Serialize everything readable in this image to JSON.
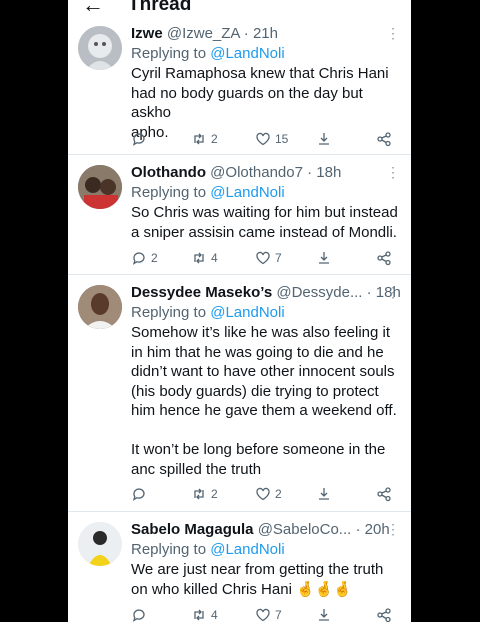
{
  "header": {
    "title": "Thread",
    "back_icon": "arrow-left-icon"
  },
  "tweets": [
    {
      "display_name": "Izwe",
      "handle": "@Izwe_ZA",
      "time": "· 21h",
      "replying_prefix": "Replying to ",
      "replying_to": "@LandNoli",
      "text": "Cyril Ramaphosa knew that Chris Hani\nhad no body guards on the day but askho\napho.",
      "replies": "",
      "retweets": "2",
      "likes": "15"
    },
    {
      "display_name": "Olothando",
      "handle": "@Olothando7",
      "time": "· 18h",
      "replying_prefix": "Replying to ",
      "replying_to": "@LandNoli",
      "text": "So Chris was waiting for him but instead\na sniper assisin came instead of Mondli.",
      "replies": "2",
      "retweets": "4",
      "likes": "7"
    },
    {
      "display_name": "Dessydee Maseko’s",
      "handle": "@Dessyde...",
      "time": "· 18h",
      "replying_prefix": "Replying to ",
      "replying_to": "@LandNoli",
      "text": "Somehow it’s like he was also feeling it\nin him that he was going to die and he\ndidn’t want to have other innocent souls\n(his body guards) die trying to protect\nhim hence he gave them a weekend off.\n\nIt won’t be long before someone in the\nanc spilled the truth",
      "replies": "",
      "retweets": "2",
      "likes": "2"
    },
    {
      "display_name": "Sabelo Magagula",
      "handle": "@SabeloCo...",
      "time": "· 20h",
      "replying_prefix": "Replying to ",
      "replying_to": "@LandNoli",
      "text": "We are just near from getting the truth\non who killed Chris Hani 🤞🤞🤞",
      "replies": "",
      "retweets": "4",
      "likes": "7"
    }
  ],
  "colors": {
    "link": "#1d9bf0",
    "muted": "#536471",
    "text": "#0f1419"
  }
}
